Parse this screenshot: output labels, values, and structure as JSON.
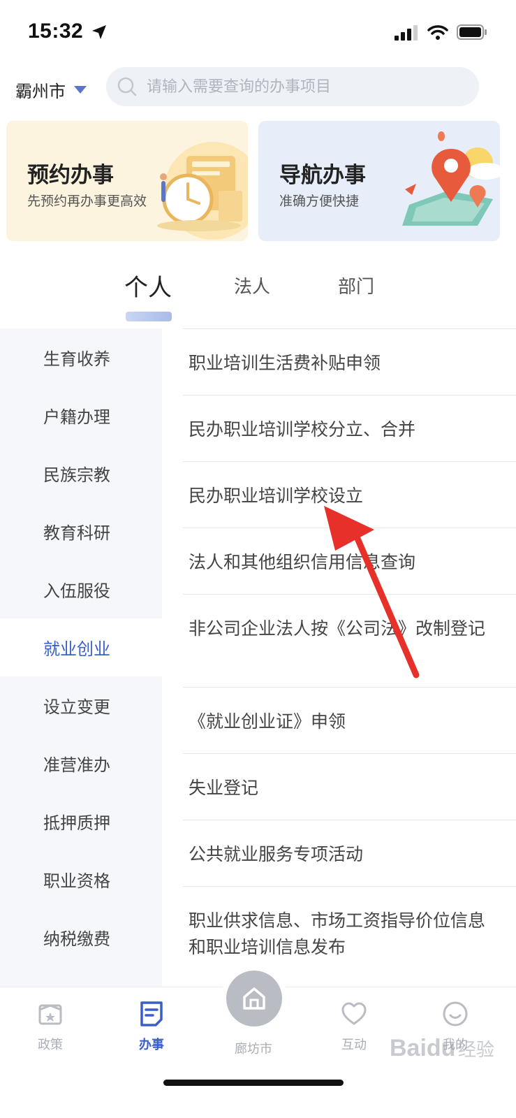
{
  "status_bar": {
    "time": "15:32"
  },
  "header": {
    "city": "霸州市",
    "search_placeholder": "请输入需要查询的办事项目"
  },
  "banners": [
    {
      "title": "预约办事",
      "subtitle": "先预约再办事更高效"
    },
    {
      "title": "导航办事",
      "subtitle": "准确方便快捷"
    }
  ],
  "tabs": [
    {
      "label": "个人",
      "active": true
    },
    {
      "label": "法人",
      "active": false
    },
    {
      "label": "部门",
      "active": false
    }
  ],
  "sidebar": {
    "items": [
      {
        "label": "生育收养"
      },
      {
        "label": "户籍办理"
      },
      {
        "label": "民族宗教"
      },
      {
        "label": "教育科研"
      },
      {
        "label": "入伍服役"
      },
      {
        "label": "就业创业",
        "active": true
      },
      {
        "label": "设立变更"
      },
      {
        "label": "准营准办"
      },
      {
        "label": "抵押质押"
      },
      {
        "label": "职业资格"
      },
      {
        "label": "纳税缴费"
      },
      {
        "label": ""
      }
    ]
  },
  "service_list": [
    {
      "label": "职业培训生活费补贴申领"
    },
    {
      "label": "民办职业培训学校分立、合并"
    },
    {
      "label": "民办职业培训学校设立"
    },
    {
      "label": "法人和其他组织信用信息查询"
    },
    {
      "label": "非公司企业法人按《公司法》改制登记"
    },
    {
      "label": "《就业创业证》申领"
    },
    {
      "label": "失业登记"
    },
    {
      "label": "公共就业服务专项活动"
    },
    {
      "label": "职业供求信息、市场工资指导价位信息和职业培训信息发布"
    }
  ],
  "bottom_nav": [
    {
      "label": "政策",
      "icon": "policy-icon"
    },
    {
      "label": "办事",
      "icon": "affairs-icon",
      "active": true
    },
    {
      "label": "廊坊市",
      "icon": "home-icon"
    },
    {
      "label": "互动",
      "icon": "heart-icon"
    },
    {
      "label": "我的",
      "icon": "smile-icon"
    }
  ],
  "watermark": "Baidu 经验",
  "colors": {
    "accent": "#3a5fc8",
    "arrow": "#e8302a",
    "sidebar_bg": "#f5f7fa"
  }
}
